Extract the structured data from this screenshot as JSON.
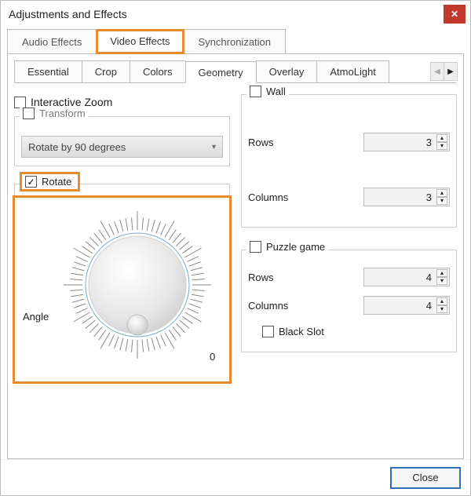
{
  "window": {
    "title": "Adjustments and Effects"
  },
  "topTabs": {
    "audio": "Audio Effects",
    "video": "Video Effects",
    "sync": "Synchronization"
  },
  "subTabs": {
    "essential": "Essential",
    "crop": "Crop",
    "colors": "Colors",
    "geometry": "Geometry",
    "overlay": "Overlay",
    "atmolight": "AtmoLight"
  },
  "left": {
    "interactiveZoom": "Interactive Zoom",
    "transform": "Transform",
    "transformValue": "Rotate by 90 degrees",
    "rotate": "Rotate",
    "angleLabel": "Angle",
    "angleZero": "0"
  },
  "right": {
    "wall": "Wall",
    "rows": "Rows",
    "columns": "Columns",
    "wallRows": "3",
    "wallCols": "3",
    "puzzle": "Puzzle game",
    "puzzleRows": "4",
    "puzzleCols": "4",
    "blackSlot": "Black Slot"
  },
  "buttons": {
    "close": "Close"
  }
}
